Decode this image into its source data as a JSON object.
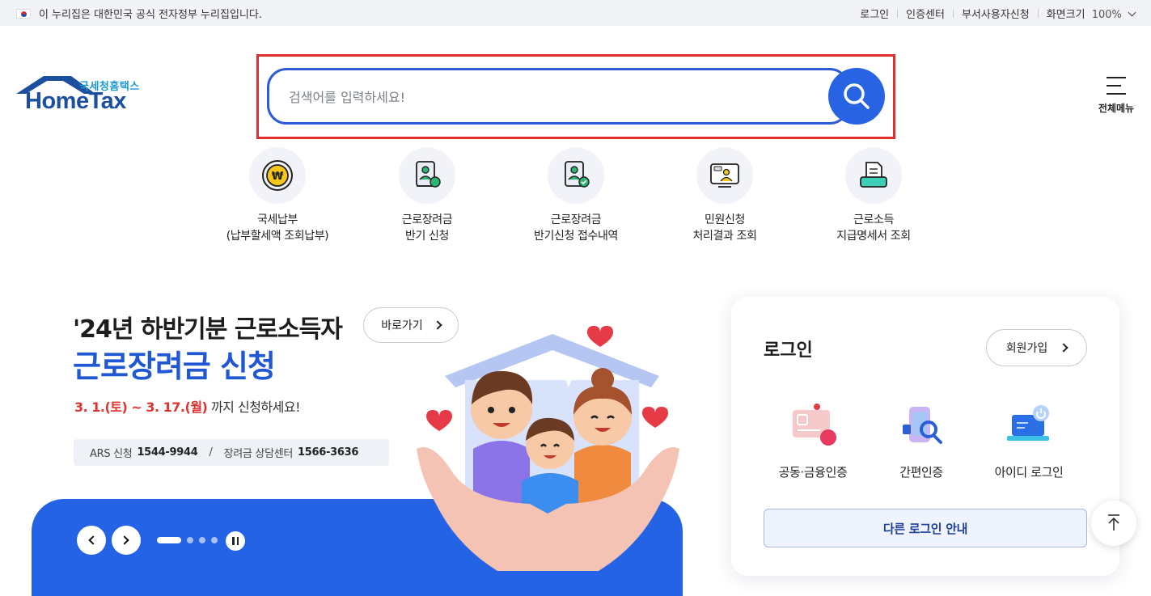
{
  "topbar": {
    "gov_notice": "이 누리집은 대한민국 공식 전자정부 누리집입니다.",
    "links": [
      "로그인",
      "인증센터",
      "부서사용자신청"
    ],
    "zoom_label": "화면크기",
    "zoom_value": "100%"
  },
  "logo": {
    "small": "국세청홈택스",
    "big": "HomeTax"
  },
  "search": {
    "placeholder": "검색어를 입력하세요!",
    "value": ""
  },
  "menu": {
    "label": "전체메뉴"
  },
  "quick_menu": [
    {
      "line1": "국세납부",
      "line2": "(납부할세액 조회납부)",
      "icon": "won-coin-icon"
    },
    {
      "line1": "근로장려금",
      "line2": "반기 신청",
      "icon": "document-person-icon"
    },
    {
      "line1": "근로장려금",
      "line2": "반기신청 접수내역",
      "icon": "document-check-icon"
    },
    {
      "line1": "민원신청",
      "line2": "처리결과 조회",
      "icon": "monitor-person-icon"
    },
    {
      "line1": "근로소득",
      "line2": "지급명세서 조회",
      "icon": "printer-document-icon"
    }
  ],
  "banner": {
    "title1": "'24년 하반기분 근로소득자",
    "title2": "근로장려금 신청",
    "goto_label": "바로가기",
    "date_red": "3. 1.(토) ~ 3. 17.(월)",
    "date_rest": " 까지 신청하세요!",
    "ars_label": "ARS 신청",
    "ars_number": "1544-9944",
    "center_label": "장려금 상담센터",
    "center_number": "1566-3636",
    "slide_count": 4,
    "active_slide": 1
  },
  "login": {
    "title": "로그인",
    "join_label": "회원가입",
    "options": [
      "공동·금융인증",
      "간편인증",
      "아이디 로그인"
    ],
    "other_label": "다른 로그인 안내"
  },
  "colors": {
    "brand_blue": "#2463e6",
    "accent_red": "#e0322e",
    "frame_red": "#e02e2e"
  }
}
